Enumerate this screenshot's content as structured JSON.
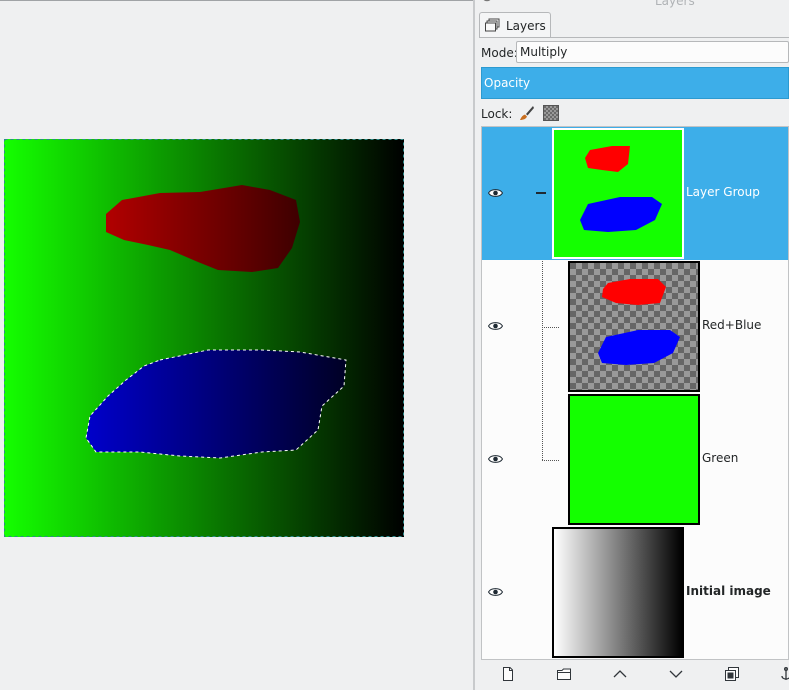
{
  "dock": {
    "title": "Layers",
    "tab_label": "Layers",
    "mode_label": "Mode:",
    "mode_value": "Multiply",
    "opacity_label": "Opacity",
    "lock_label": "Lock:"
  },
  "layers": [
    {
      "name": "Layer Group",
      "selected": true,
      "visible": true,
      "bold": false
    },
    {
      "name": "Red+Blue",
      "selected": false,
      "visible": true,
      "bold": false
    },
    {
      "name": "Green",
      "selected": false,
      "visible": true,
      "bold": false
    },
    {
      "name": "Initial image",
      "selected": false,
      "visible": true,
      "bold": true
    }
  ],
  "icons": {
    "tab": "layers-icon",
    "eye": "eye-icon",
    "lock_pixels": "paintbrush-icon",
    "lock_alpha": "checkerboard-icon",
    "bottom": [
      "new-layer-icon",
      "new-group-icon",
      "raise-icon",
      "lower-icon",
      "duplicate-icon",
      "anchor-icon"
    ]
  },
  "colors": {
    "accent": "#3daee9",
    "canvas_green": "#14ff00",
    "shape_red": "#cc0000",
    "shape_blue": "#0000cc"
  }
}
